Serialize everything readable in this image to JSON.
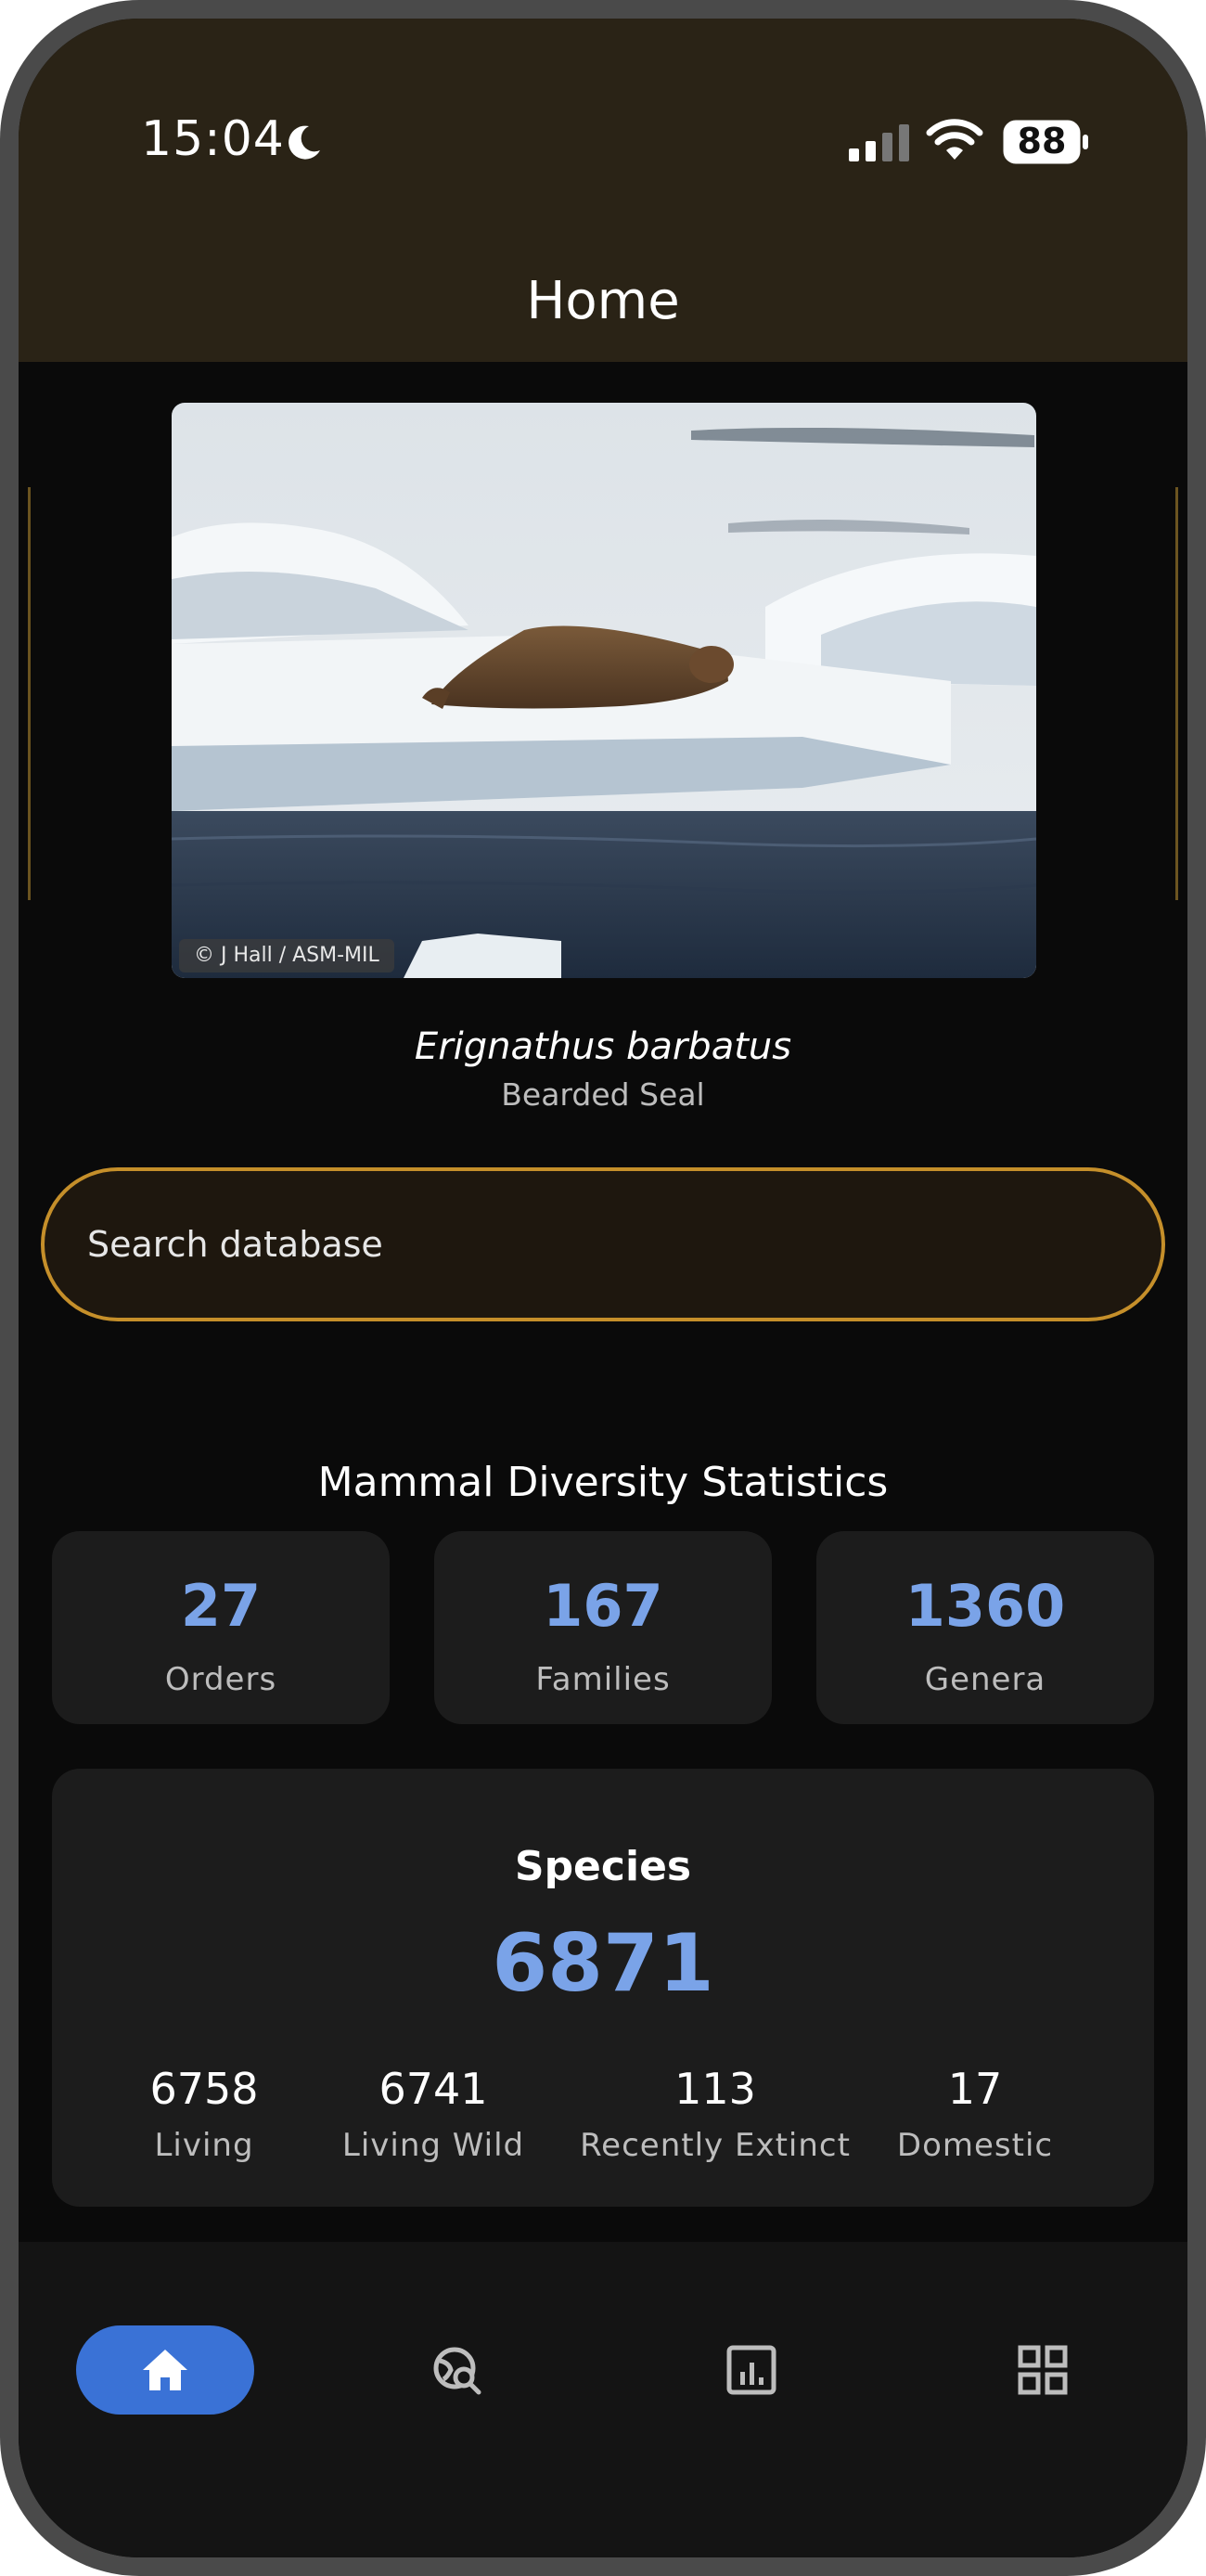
{
  "status_bar": {
    "time": "15:04",
    "battery": "88",
    "icons": [
      "moon-icon",
      "signal-icon",
      "wifi-icon",
      "battery-icon"
    ]
  },
  "header": {
    "title": "Home"
  },
  "featured": {
    "photo_credit": "© J Hall / ASM-MIL",
    "scientific_name": "Erignathus barbatus",
    "common_name": "Bearded Seal"
  },
  "search": {
    "placeholder": "Search database"
  },
  "stats": {
    "title": "Mammal Diversity Statistics",
    "cards": [
      {
        "value": "27",
        "label": "Orders"
      },
      {
        "value": "167",
        "label": "Families"
      },
      {
        "value": "1360",
        "label": "Genera"
      }
    ],
    "species": {
      "title": "Species",
      "total": "6871",
      "breakdown": [
        {
          "value": "6758",
          "label": "Living"
        },
        {
          "value": "6741",
          "label": "Living Wild"
        },
        {
          "value": "113",
          "label": "Recently Extinct"
        },
        {
          "value": "17",
          "label": "Domestic"
        }
      ]
    }
  },
  "nav": {
    "items": [
      {
        "icon": "home-icon",
        "active": true
      },
      {
        "icon": "globe-search-icon",
        "active": false
      },
      {
        "icon": "chart-icon",
        "active": false
      },
      {
        "icon": "grid-icon",
        "active": false
      }
    ]
  },
  "colors": {
    "accent": "#7aa3e8",
    "search_border": "#c58f2a",
    "nav_active": "#3a72d6",
    "header_bg": "#2a2316"
  }
}
